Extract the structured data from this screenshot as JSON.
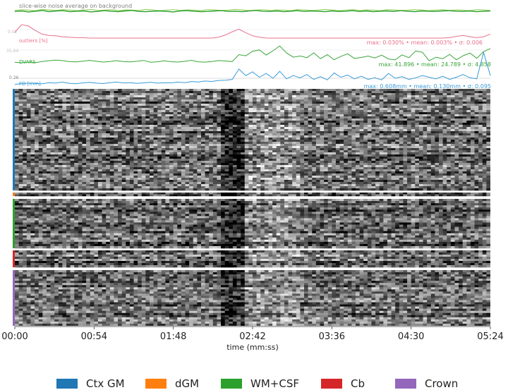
{
  "chart_data": {
    "type": "carpet",
    "panels": [
      {
        "label": "slice-wise noise average on background",
        "color_a": "#2ca02c",
        "color_b": "#9bd36a",
        "series_a": [
          0.48,
          0.5,
          0.46,
          0.49,
          0.52,
          0.47,
          0.5,
          0.51,
          0.47,
          0.49,
          0.5,
          0.46,
          0.48,
          0.51,
          0.49,
          0.47,
          0.5,
          0.52,
          0.48,
          0.47,
          0.49,
          0.5,
          0.48,
          0.46,
          0.5,
          0.51,
          0.49,
          0.47,
          0.48,
          0.5,
          0.51,
          0.48,
          0.49,
          0.47,
          0.5,
          0.52,
          0.49,
          0.48,
          0.5,
          0.47,
          0.49,
          0.51,
          0.48,
          0.5,
          0.49,
          0.47,
          0.5,
          0.48,
          0.49,
          0.51,
          0.48,
          0.5,
          0.47,
          0.49,
          0.5,
          0.48,
          0.51,
          0.49,
          0.47,
          0.5,
          0.49,
          0.48,
          0.5,
          0.51,
          0.49,
          0.48,
          0.5,
          0.47,
          0.49,
          0.5
        ],
        "series_b": [
          0.52,
          0.55,
          0.53,
          0.51,
          0.56,
          0.54,
          0.52,
          0.55,
          0.53,
          0.51,
          0.54,
          0.56,
          0.52,
          0.53,
          0.55,
          0.51,
          0.54,
          0.53,
          0.52,
          0.56,
          0.54,
          0.51,
          0.53,
          0.55,
          0.52,
          0.54,
          0.53,
          0.51,
          0.55,
          0.54,
          0.52,
          0.53,
          0.56,
          0.54,
          0.51,
          0.53,
          0.55,
          0.52,
          0.54,
          0.53,
          0.51,
          0.55,
          0.54,
          0.52,
          0.53,
          0.56,
          0.54,
          0.51,
          0.53,
          0.55,
          0.52,
          0.54,
          0.53,
          0.51,
          0.55,
          0.54,
          0.52,
          0.53,
          0.55,
          0.54,
          0.51,
          0.53,
          0.55,
          0.52,
          0.54,
          0.53,
          0.51,
          0.55,
          0.54,
          0.52
        ]
      },
      {
        "label": "outliers [%]",
        "ytick": "0.02",
        "color": "#e8718b",
        "stats": "max: 0.030% • mean: 0.003% • σ: 0.006",
        "values": [
          0.013,
          0.03,
          0.027,
          0.017,
          0.009,
          0.006,
          0.005,
          0.003,
          0.002,
          0.001,
          0.001,
          0.0,
          0.0,
          0.0,
          0.0,
          0.0,
          0.0,
          0.0,
          0.0,
          0.0,
          0.0,
          0.0,
          0.0,
          0.0,
          0.0,
          0.0,
          0.0,
          0.0,
          0.0,
          0.0,
          0.002,
          0.007,
          0.014,
          0.02,
          0.012,
          0.005,
          0.002,
          0.0,
          0.0,
          0.0,
          0.0,
          0.0,
          0.0,
          0.0,
          0.0,
          0.0,
          0.0,
          0.0,
          0.0,
          0.0,
          0.0,
          0.0,
          0.0,
          0.0,
          0.0,
          0.0,
          0.0,
          0.0,
          0.0,
          0.0,
          0.0,
          0.0,
          0.0,
          0.0,
          0.001,
          0.004,
          0.006,
          0.003,
          0.001,
          0.003,
          0.009
        ]
      },
      {
        "label": "DVARS",
        "ytick": "35.64",
        "color": "#3aa63a",
        "stats": "max: 41.896 • mean: 24.789 • σ: 4.858",
        "values": [
          21.5,
          20.8,
          21.8,
          21.0,
          22.5,
          23.4,
          24.1,
          23.6,
          22.3,
          21.9,
          22.8,
          23.9,
          22.7,
          21.8,
          22.4,
          23.5,
          22.3,
          21.9,
          22.7,
          23.8,
          21.6,
          22.1,
          23.3,
          22.2,
          21.8,
          22.6,
          24.0,
          22.1,
          21.7,
          22.4,
          23.6,
          23.1,
          22.4,
          31.0,
          29.6,
          35.2,
          37.0,
          30.5,
          35.8,
          41.9,
          33.1,
          27.8,
          29.3,
          27.2,
          33.2,
          26.1,
          31.0,
          24.7,
          28.9,
          32.1,
          26.3,
          27.5,
          29.2,
          26.9,
          30.4,
          25.6,
          24.5,
          30.7,
          27.2,
          35.6,
          34.0,
          23.4,
          27.8,
          26.0,
          31.3,
          24.6,
          29.7,
          33.0,
          26.4,
          34.8,
          38.7
        ]
      },
      {
        "label": "FD [mm]",
        "ytick": "0.26",
        "color": "#3a9bd6",
        "stats": "max: 0.608mm • mean: 0.130mm • σ: 0.095",
        "values": [
          0.02,
          0.03,
          0.04,
          0.035,
          0.028,
          0.05,
          0.042,
          0.06,
          0.038,
          0.03,
          0.045,
          0.055,
          0.04,
          0.032,
          0.048,
          0.06,
          0.044,
          0.05,
          0.036,
          0.045,
          0.058,
          0.04,
          0.05,
          0.046,
          0.06,
          0.048,
          0.07,
          0.062,
          0.08,
          0.072,
          0.09,
          0.094,
          0.11,
          0.3,
          0.18,
          0.25,
          0.15,
          0.22,
          0.13,
          0.26,
          0.12,
          0.18,
          0.14,
          0.2,
          0.11,
          0.16,
          0.1,
          0.23,
          0.15,
          0.19,
          0.12,
          0.17,
          0.11,
          0.14,
          0.1,
          0.22,
          0.13,
          0.16,
          0.11,
          0.14,
          0.18,
          0.15,
          0.12,
          0.17,
          0.11,
          0.15,
          0.2,
          0.14,
          0.12,
          0.608,
          0.18
        ]
      }
    ],
    "carpet_groups": [
      {
        "name": "Ctx GM",
        "color": "#1f77b4"
      },
      {
        "name": "dGM",
        "color": "#ff7f0e"
      },
      {
        "name": "WM+CSF",
        "color": "#2ca02c"
      },
      {
        "name": "Cb",
        "color": "#d62728"
      },
      {
        "name": "Crown",
        "color": "#9467bd"
      }
    ],
    "xticks": [
      "00:00",
      "00:54",
      "01:48",
      "02:42",
      "03:36",
      "04:30",
      "05:24"
    ],
    "xlabel": "time (mm:ss)",
    "legend_position": "bottom"
  }
}
